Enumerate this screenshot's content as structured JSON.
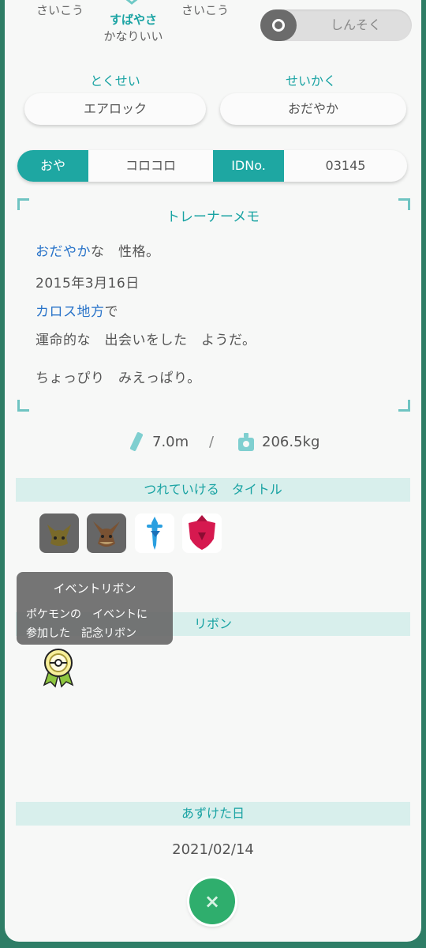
{
  "stats": {
    "left": "さいこう",
    "center": "すばやさ",
    "center_sub": "かなりいい",
    "right": "さいこう"
  },
  "toggle": {
    "label": "しんそく",
    "on": false
  },
  "ability": {
    "label": "とくせい",
    "value": "エアロック"
  },
  "nature": {
    "label": "せいかく",
    "value": "おだやか"
  },
  "ot": {
    "label": "おや",
    "value": "コロコロ",
    "id_label": "IDNo.",
    "id_value": "03145"
  },
  "memo": {
    "title": "トレーナーメモ",
    "nature_hl": "おだやか",
    "nature_rest": "な　性格。",
    "date": "2015年3月16日",
    "region_hl": "カロス地方",
    "region_rest": "で",
    "meeting": "運命的な　出会いをした　ようだ。",
    "characteristic": "ちょっぴり　みえっぱり。"
  },
  "measure": {
    "height": "7.0m",
    "sep": "/",
    "weight": "206.5kg"
  },
  "titles": {
    "header": "つれていける　タイトル",
    "icons": [
      "pikachu-mark-icon",
      "eevee-mark-icon",
      "sword-mark-icon",
      "shield-mark-icon"
    ]
  },
  "ribbons": {
    "header": "リボン",
    "icons": [
      "event-ribbon-icon"
    ]
  },
  "tooltip": {
    "title": "イベントリボン",
    "line1": "ポケモンの　イベントに",
    "line2": "参加した　記念リボン"
  },
  "deposit": {
    "header": "あずけた日",
    "date": "2021/02/14"
  },
  "close": {
    "label": "×"
  },
  "colors": {
    "accent": "#1ea7a2",
    "link": "#2a74c9",
    "background": "#2e7d66"
  }
}
